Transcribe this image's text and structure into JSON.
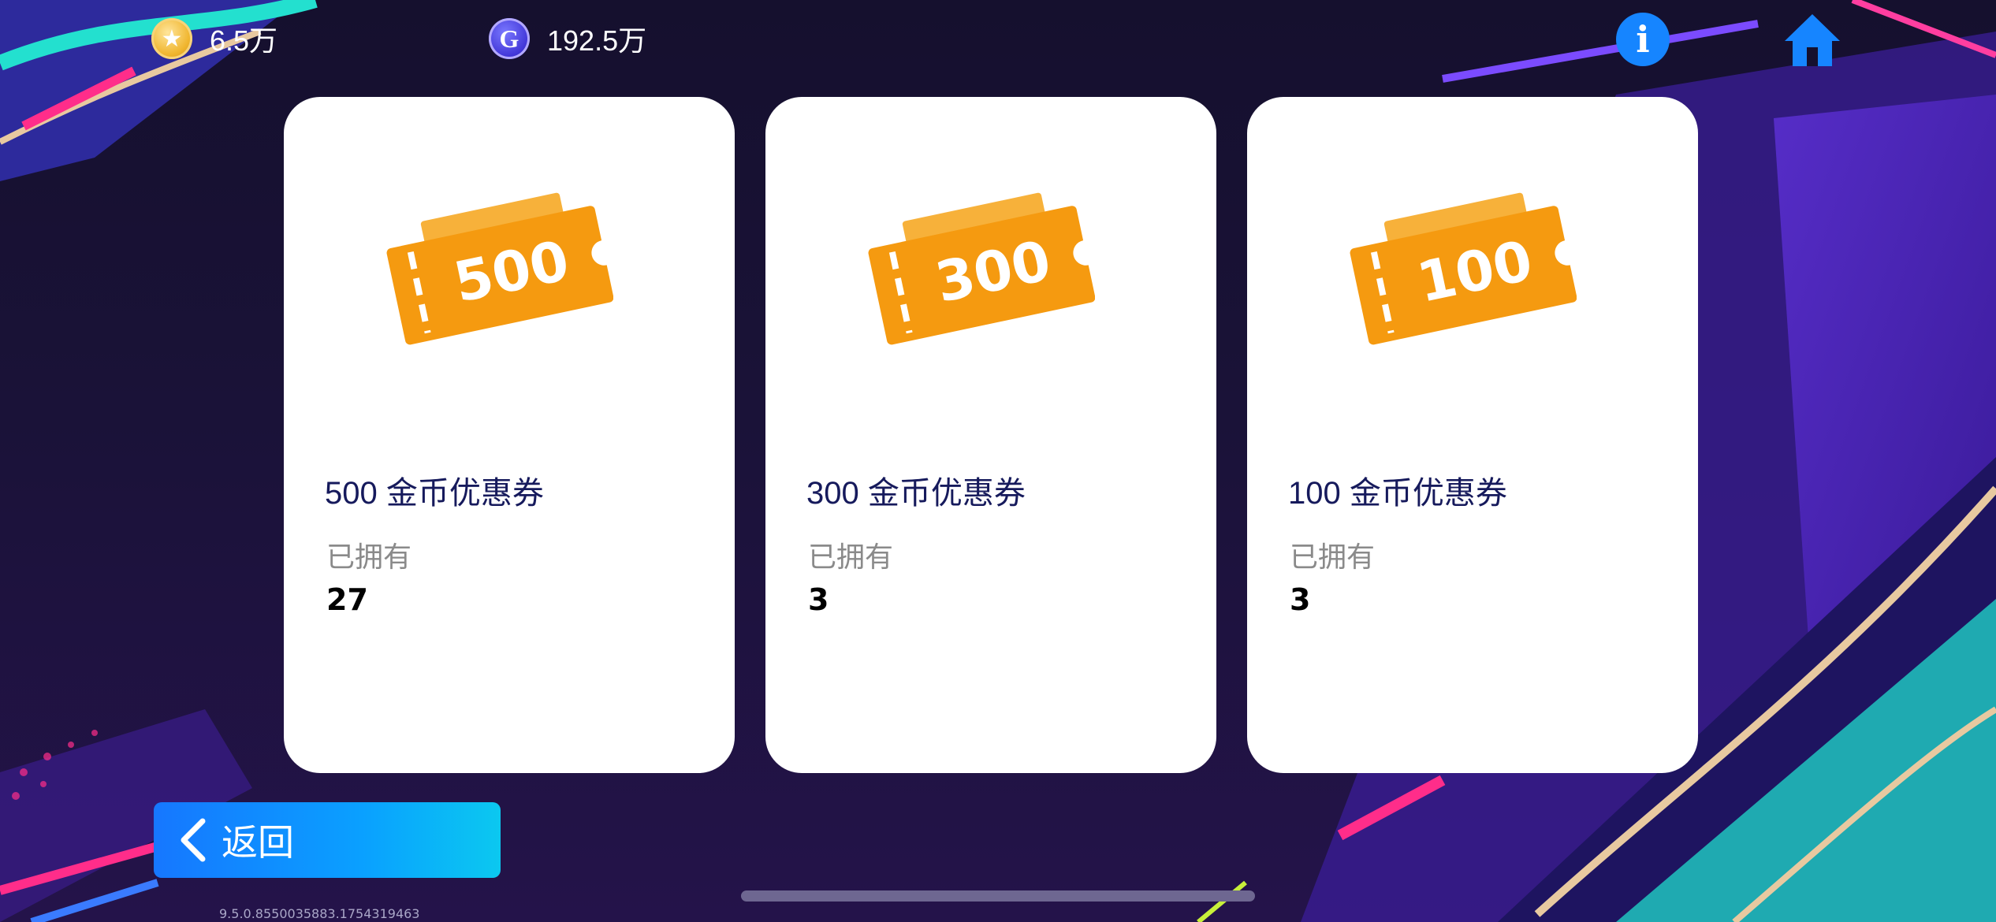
{
  "currency": {
    "coins": {
      "icon": "star-coin-icon",
      "value": "6.5万"
    },
    "gems": {
      "icon": "g-coin-icon",
      "value": "192.5万"
    }
  },
  "header": {
    "info_icon": "info-icon",
    "home_icon": "home-icon"
  },
  "cards": [
    {
      "ticket_value": "500",
      "title": "500 金币优惠券",
      "owned_label": "已拥有",
      "count": "27"
    },
    {
      "ticket_value": "300",
      "title": "300 金币优惠券",
      "owned_label": "已拥有",
      "count": "3"
    },
    {
      "ticket_value": "100",
      "title": "100 金币优惠券",
      "owned_label": "已拥有",
      "count": "3"
    }
  ],
  "back_button": {
    "label": "返回"
  },
  "version": "9.5.0.8550035883.1754319463",
  "colors": {
    "accent": "#1685ff",
    "ticket": "#f59a10",
    "title": "#161a5c"
  }
}
